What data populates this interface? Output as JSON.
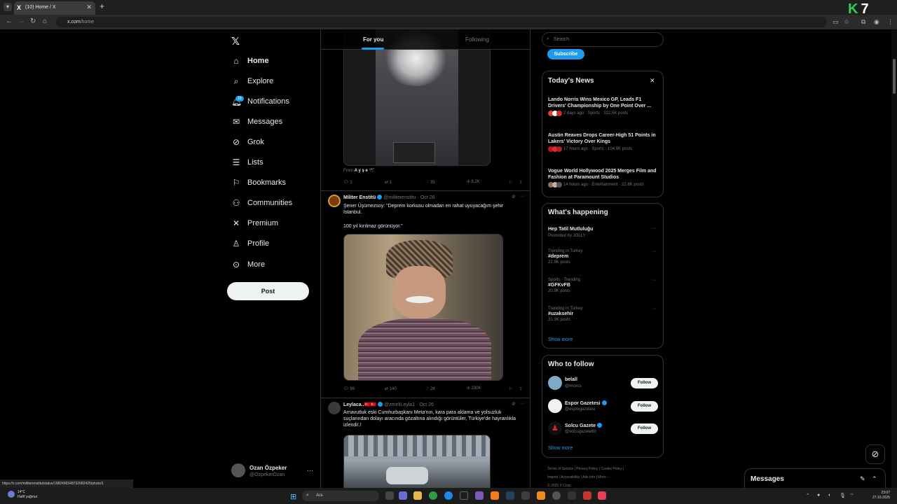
{
  "browser": {
    "tab_title": "(10) Home / X",
    "tab_favicon": "X",
    "url_host": "x.com",
    "url_path": "/home",
    "status_url": "https://x.com/militerenstitu/status/1982490348732682425/photo/1",
    "corner_logo_k": "K",
    "corner_logo_n": "7"
  },
  "nav": {
    "items": [
      {
        "label": "Home",
        "icon": "home-icon"
      },
      {
        "label": "Explore",
        "icon": "search-icon"
      },
      {
        "label": "Notifications",
        "icon": "bell-icon"
      },
      {
        "label": "Messages",
        "icon": "envelope-icon"
      },
      {
        "label": "Grok",
        "icon": "grok-icon"
      },
      {
        "label": "Lists",
        "icon": "list-icon"
      },
      {
        "label": "Bookmarks",
        "icon": "bookmark-icon"
      },
      {
        "label": "Communities",
        "icon": "people-icon"
      },
      {
        "label": "Premium",
        "icon": "x-icon"
      },
      {
        "label": "Profile",
        "icon": "person-icon"
      },
      {
        "label": "More",
        "icon": "more-circle-icon"
      }
    ],
    "notifications_badge": "10",
    "post_label": "Post",
    "profile": {
      "name": "Ozan Özpeker",
      "handle": "@OzpekerOzan",
      "more": "···"
    }
  },
  "feed": {
    "tabs": {
      "for_you": "For you",
      "following": "Following"
    },
    "tweet1": {
      "source_prefix": "From",
      "source_name": "A y ş e",
      "source_emoji": "🕊",
      "replies": "1",
      "reposts": "1",
      "likes": "35",
      "views": "8.2K"
    },
    "tweet2": {
      "name": "Militer Enstitü",
      "handle": "@militerenstitu",
      "date": "Oct 26",
      "text1": "Şener Üşümezsoy: \"Deprem korkusu olmadan en rahat uyuyacağım şehir İstanbul.",
      "text2": "100 yıl kırılmaz görünüyor.\"",
      "replies": "99",
      "reposts": "140",
      "likes": "2K",
      "views": "230K"
    },
    "tweet3": {
      "name": "Leylaca..🇹🇷🇹🇷",
      "handle": "@zmirliLeyla1",
      "date": "Oct 26",
      "text": "Arnavutluk eski Cumhurbaşkanı Meta'nın, kara para aklama ve yolsuzluk suçlarından dolayı aracında gözaltına alındığı görüntüler, Türkiye'de hayranlıkla izlendi!.!"
    }
  },
  "right": {
    "search_placeholder": "Search",
    "subscribe_label": "Subscribe",
    "news": {
      "title": "Today's News",
      "close": "✕",
      "items": [
        {
          "headline": "Lando Norris Wins Mexico GP, Leads F1 Drivers' Championship by One Point Over ...",
          "meta": "2 days ago · Sports · 312.5K posts"
        },
        {
          "headline": "Austin Reaves Drops Career-High 51 Points in Lakers' Victory Over Kings",
          "meta": "17 hours ago · Sports · 104.9K posts"
        },
        {
          "headline": "Vogue World Hollywood 2025 Merges Film and Fashion at Paramount Studios",
          "meta": "14 hours ago · Entertainment · 22.8K posts"
        }
      ]
    },
    "happening": {
      "title": "What's happening",
      "promoted": {
        "tag": "Hep Tatil Mutluluğu",
        "by": "Promoted by JOLLY"
      },
      "trends": [
        {
          "context": "Trending in Turkey",
          "tag": "#deprem",
          "count": "22.9K posts"
        },
        {
          "context": "Sports · Trending",
          "tag": "#GFKvFB",
          "count": "20.9K posts"
        },
        {
          "context": "Trending in Turkey",
          "tag": "#uzaksehir",
          "count": "31.1K posts"
        }
      ],
      "show_more": "Show more"
    },
    "follow": {
      "title": "Who to follow",
      "users": [
        {
          "name": "belall",
          "handle": "@lmorcs",
          "button": "Follow"
        },
        {
          "name": "Espor Gazetesi",
          "handle": "@esporgazetesi",
          "button": "Follow"
        },
        {
          "name": "Solcu Gazete",
          "handle": "@solcugazete60",
          "button": "Follow"
        }
      ],
      "show_more": "Show more"
    },
    "footer": {
      "line1": "Terms of Service  |  Privacy Policy  |  Cookie Policy  |",
      "line2": "Imprint  |  Accessibility  |  Ads info  |  More ···",
      "line3": "© 2025 X Corp."
    }
  },
  "messages_drawer": {
    "title": "Messages"
  },
  "taskbar": {
    "weather_temp": "14°C",
    "weather_desc": "Hafif yağmur",
    "search_label": "Ara",
    "time": "23:07",
    "date": "27.10.2025"
  },
  "colors": {
    "accent": "#1d9bf0",
    "background": "#000000",
    "border": "#2f3336",
    "muted": "#71767b"
  }
}
